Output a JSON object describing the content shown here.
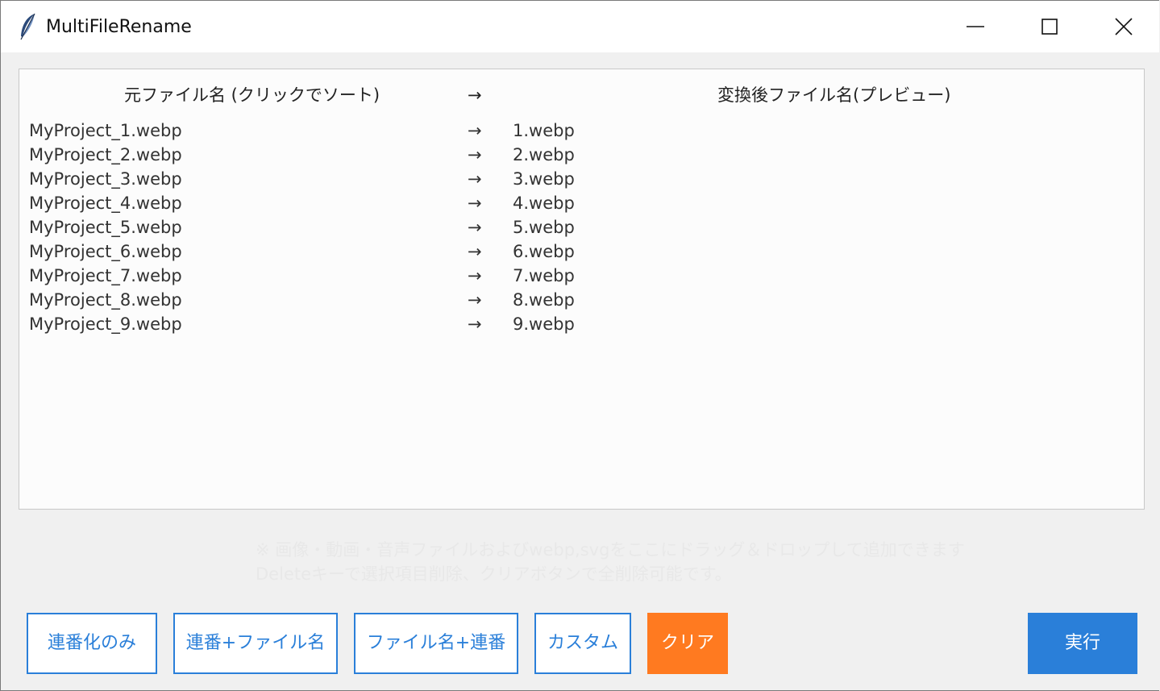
{
  "window": {
    "title": "MultiFileRename"
  },
  "list": {
    "header_source": "元ファイル名 (クリックでソート)",
    "header_arrow": "→",
    "header_target": "変換後ファイル名(プレビュー)",
    "rows": [
      {
        "src": "MyProject_1.webp",
        "arrow": "→",
        "dst": "1.webp"
      },
      {
        "src": "MyProject_2.webp",
        "arrow": "→",
        "dst": "2.webp"
      },
      {
        "src": "MyProject_3.webp",
        "arrow": "→",
        "dst": "3.webp"
      },
      {
        "src": "MyProject_4.webp",
        "arrow": "→",
        "dst": "4.webp"
      },
      {
        "src": "MyProject_5.webp",
        "arrow": "→",
        "dst": "5.webp"
      },
      {
        "src": "MyProject_6.webp",
        "arrow": "→",
        "dst": "6.webp"
      },
      {
        "src": "MyProject_7.webp",
        "arrow": "→",
        "dst": "7.webp"
      },
      {
        "src": "MyProject_8.webp",
        "arrow": "→",
        "dst": "8.webp"
      },
      {
        "src": "MyProject_9.webp",
        "arrow": "→",
        "dst": "9.webp"
      }
    ]
  },
  "hint": {
    "line1": "※ 画像・動画・音声ファイルおよびwebp,svgをここにドラッグ＆ドロップして追加できます",
    "line2": "Deleteキーで選択項目削除、クリアボタンで全削除可能です。"
  },
  "buttons": {
    "seq_only": "連番化のみ",
    "seq_name": "連番+ファイル名",
    "name_seq": "ファイル名+連番",
    "custom": "カスタム",
    "clear": "クリア",
    "run": "実行"
  },
  "colors": {
    "accent": "#2a7fd9",
    "clear": "#ff7a20"
  }
}
